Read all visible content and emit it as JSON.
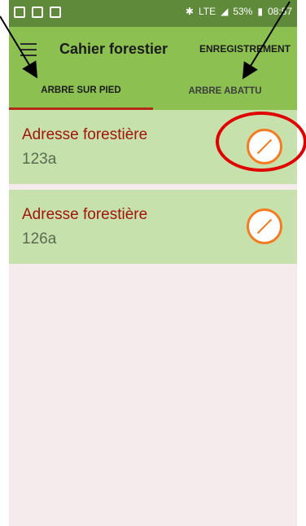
{
  "status": {
    "lte": "LTE",
    "battery": "53%",
    "time": "08:57"
  },
  "toolbar": {
    "title": "Cahier forestier",
    "action": "ENREGISTREMENT"
  },
  "tabs": [
    {
      "label": "ARBRE SUR PIED",
      "active": true
    },
    {
      "label": "ARBRE ABATTU",
      "active": false
    }
  ],
  "list": [
    {
      "title": "Adresse forestière",
      "subtitle": "123a"
    },
    {
      "title": "Adresse forestière",
      "subtitle": "126a"
    }
  ],
  "colors": {
    "primary": "#8cc152",
    "status": "#5f8a39",
    "accent": "#f57b20",
    "title": "#a3140c",
    "card": "#c7e1ad"
  }
}
